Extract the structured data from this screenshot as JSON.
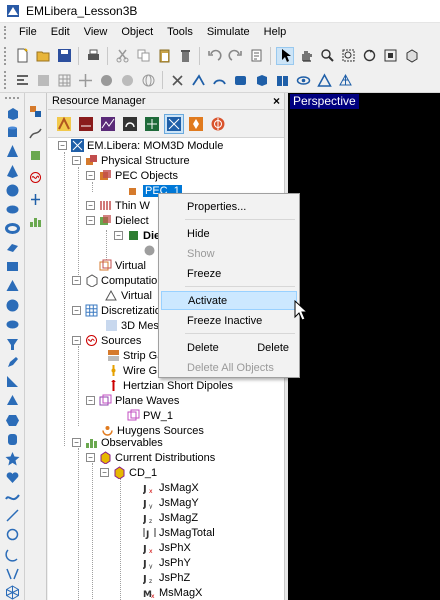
{
  "window": {
    "title": "EMLibera_Lesson3B"
  },
  "menu": [
    "File",
    "Edit",
    "View",
    "Object",
    "Tools",
    "Simulate",
    "Help"
  ],
  "resource_manager": {
    "title": "Resource Manager",
    "close_label": "×"
  },
  "tree": {
    "root": "EM.Libera: MOM3D Module",
    "physical_structure": "Physical Structure",
    "pec_objects": "PEC Objects",
    "pec_1": "PEC_1",
    "thin_wires": "Thin W",
    "dielectric": "Dielect",
    "die_child": "Die",
    "virtual1": "Virtual",
    "computational": "Computatio",
    "virtual2": "Virtual",
    "discretization": "Discretizatio",
    "mesh3d": "3D Mes",
    "sources": "Sources",
    "strip_gap": "Strip Ga",
    "wire_gap": "Wire G",
    "hertzian": "Hertzian Short Dipoles",
    "plane_waves": "Plane Waves",
    "pw1": "PW_1",
    "huygens": "Huygens Sources",
    "observables": "Observables",
    "current_distributions": "Current Distributions",
    "cd1": "CD_1",
    "jsmagx": "JsMagX",
    "jsmagy": "JsMagY",
    "jsmagz": "JsMagZ",
    "jsmagtotal": "JsMagTotal",
    "jsphx": "JsPhX",
    "jsphy": "JsPhY",
    "jsphz": "JsPhZ",
    "msmagx": "MsMagX"
  },
  "viewport": {
    "label": "Perspective"
  },
  "context_menu": {
    "properties": "Properties...",
    "hide": "Hide",
    "show": "Show",
    "freeze": "Freeze",
    "activate": "Activate",
    "freeze_inactive": "Freeze Inactive",
    "delete": "Delete",
    "delete_shortcut": "Delete",
    "delete_all": "Delete All Objects"
  },
  "colors": {
    "selection": "#0078d7",
    "viewport_bg": "#000000",
    "view_label_bg": "#00007f",
    "hover": "#cce8ff"
  }
}
